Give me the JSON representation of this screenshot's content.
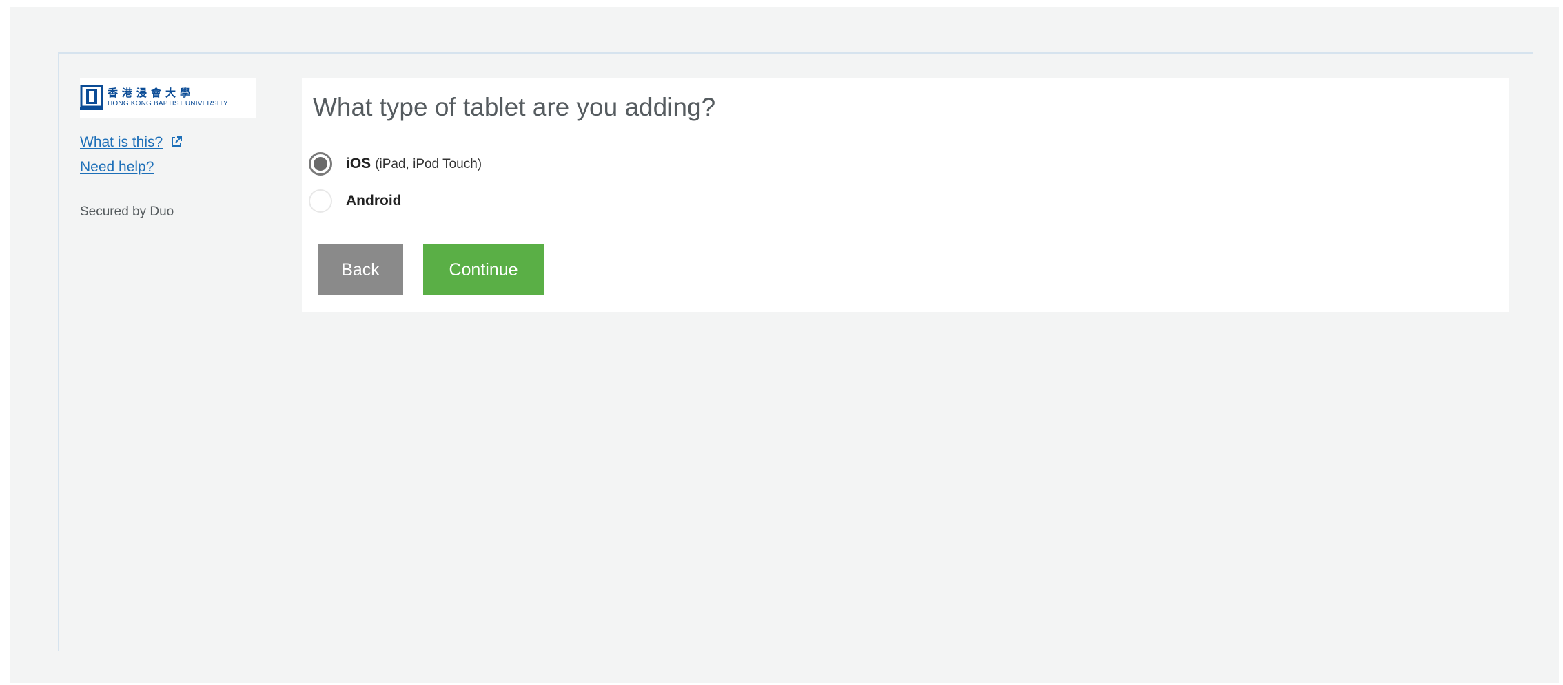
{
  "sidebar": {
    "logo": {
      "chinese": "香港浸會大學",
      "english": "HONG KONG BAPTIST UNIVERSITY"
    },
    "what_is_this": "What is this?",
    "need_help": "Need help?",
    "secured_by": "Secured by Duo"
  },
  "main": {
    "question": "What type of tablet are you adding?",
    "options": [
      {
        "label": "iOS",
        "detail": "(iPad, iPod Touch)",
        "selected": true
      },
      {
        "label": "Android",
        "detail": "",
        "selected": false
      }
    ],
    "back_label": "Back",
    "continue_label": "Continue"
  },
  "colors": {
    "link": "#1d6fb8",
    "brand": "#0b4c96",
    "continue": "#5aaf46",
    "back": "#8a8a8a"
  }
}
